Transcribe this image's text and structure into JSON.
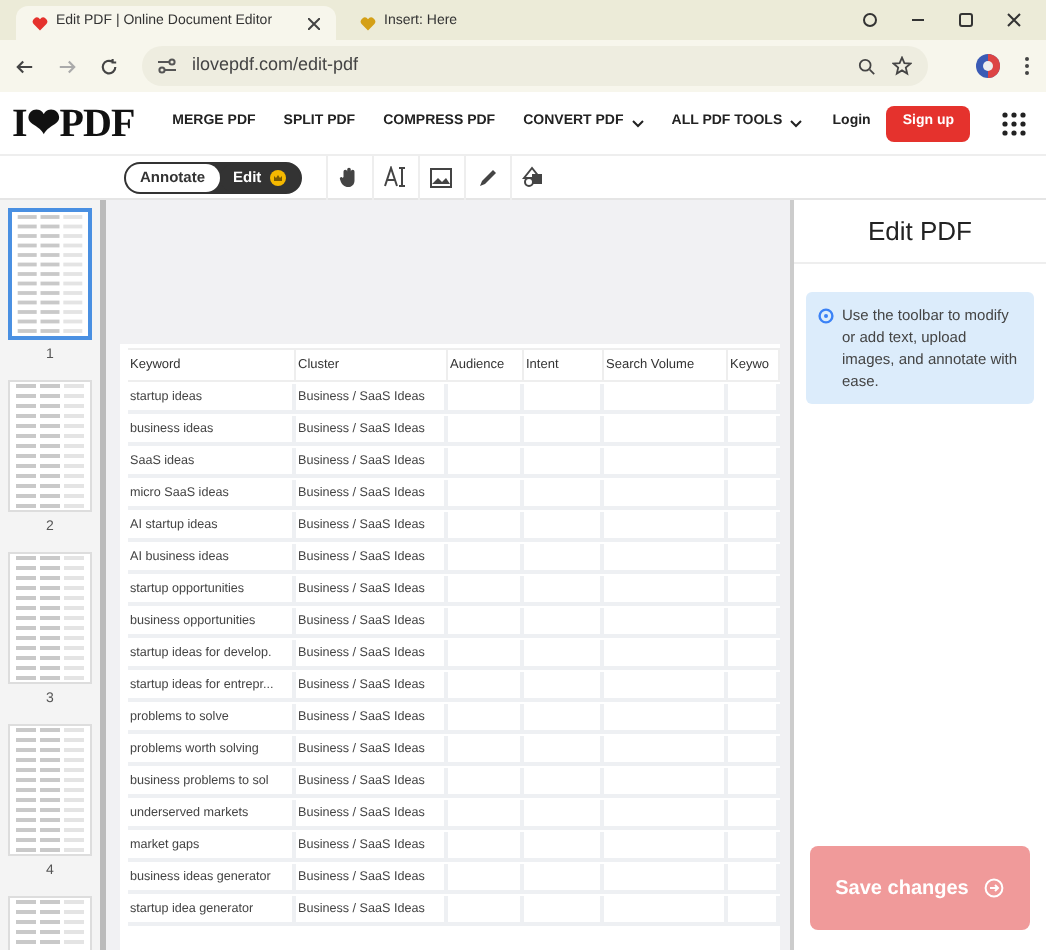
{
  "browser": {
    "tabs": [
      {
        "title": "Edit PDF | Online Document Editor",
        "selected": true
      },
      {
        "title": "Insert: Here",
        "selected": false
      }
    ],
    "url": "ilovepdf.com/edit-pdf"
  },
  "nav": {
    "logo": "I❤PDF",
    "items": [
      {
        "label": "MERGE PDF",
        "dropdown": false
      },
      {
        "label": "SPLIT PDF",
        "dropdown": false
      },
      {
        "label": "COMPRESS PDF",
        "dropdown": false
      },
      {
        "label": "CONVERT PDF",
        "dropdown": true
      },
      {
        "label": "ALL PDF TOOLS",
        "dropdown": true
      }
    ],
    "login": "Login",
    "signup": "Sign up"
  },
  "mode_toggle": [
    {
      "label": "Annotate",
      "selected": false
    },
    {
      "label": "Edit",
      "selected": true
    }
  ],
  "pages": [
    {
      "number": "1",
      "selected": true
    },
    {
      "number": "2",
      "selected": false
    },
    {
      "number": "3",
      "selected": false
    },
    {
      "number": "4",
      "selected": false
    },
    {
      "selected": false
    }
  ],
  "table": {
    "columns": [
      "Keyword",
      "Cluster",
      "Audience",
      "Intent",
      "Search Volume",
      "Keywo"
    ],
    "rows": [
      [
        "startup ideas",
        "Business / SaaS Ideas"
      ],
      [
        "business ideas",
        "Business / SaaS Ideas"
      ],
      [
        "SaaS ideas",
        "Business / SaaS Ideas"
      ],
      [
        "micro SaaS ideas",
        "Business / SaaS Ideas"
      ],
      [
        "AI startup ideas",
        "Business / SaaS Ideas"
      ],
      [
        "AI business ideas",
        "Business / SaaS Ideas"
      ],
      [
        "startup opportunities",
        "Business / SaaS Ideas"
      ],
      [
        "business opportunities",
        "Business / SaaS Ideas"
      ],
      [
        "startup ideas for develop.",
        "Business / SaaS Ideas"
      ],
      [
        "startup ideas for entrepr...",
        "Business / SaaS Ideas"
      ],
      [
        "problems to solve",
        "Business / SaaS Ideas"
      ],
      [
        "problems worth solving",
        "Business / SaaS Ideas"
      ],
      [
        "business problems to sol",
        "Business / SaaS Ideas"
      ],
      [
        "underserved markets",
        "Business / SaaS Ideas"
      ],
      [
        "market gaps",
        "Business / SaaS Ideas"
      ],
      [
        "business ideas generator",
        "Business / SaaS Ideas"
      ],
      [
        "startup idea generator",
        "Business / SaaS Ideas"
      ]
    ]
  },
  "panel": {
    "title": "Edit PDF",
    "info": "Use the toolbar to modify or add text, upload images, and annotate with ease.",
    "save_button": "Save changes"
  }
}
